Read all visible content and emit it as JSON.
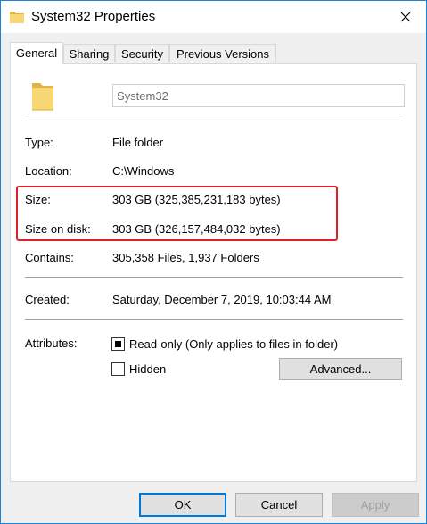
{
  "window": {
    "title": "System32 Properties"
  },
  "tabs": [
    {
      "label": "General",
      "active": true
    },
    {
      "label": "Sharing",
      "active": false
    },
    {
      "label": "Security",
      "active": false
    },
    {
      "label": "Previous Versions",
      "active": false
    }
  ],
  "general": {
    "name_value": "System32",
    "rows": {
      "type": {
        "label": "Type:",
        "value": "File folder"
      },
      "location": {
        "label": "Location:",
        "value": "C:\\Windows"
      },
      "size": {
        "label": "Size:",
        "value": "303 GB (325,385,231,183 bytes)"
      },
      "size_on_disk": {
        "label": "Size on disk:",
        "value": "303 GB (326,157,484,032 bytes)"
      },
      "contains": {
        "label": "Contains:",
        "value": "305,358 Files, 1,937 Folders"
      },
      "created": {
        "label": "Created:",
        "value": "Saturday, December 7, 2019, 10:03:44 AM"
      }
    },
    "attributes": {
      "label": "Attributes:",
      "readonly": {
        "label": "Read-only (Only applies to files in folder)",
        "state": "indeterminate"
      },
      "hidden": {
        "label": "Hidden",
        "checked": false
      },
      "advanced_label": "Advanced..."
    }
  },
  "buttons": {
    "ok": "OK",
    "cancel": "Cancel",
    "apply": "Apply"
  },
  "colors": {
    "window_border": "#1883d7",
    "highlight": "#e0202a",
    "folder": "#f8d775",
    "folder_dark": "#e0b443",
    "default_button": "#0078d7"
  },
  "icons": {
    "title": "folder-icon",
    "close": "close-icon",
    "big": "folder-icon"
  }
}
